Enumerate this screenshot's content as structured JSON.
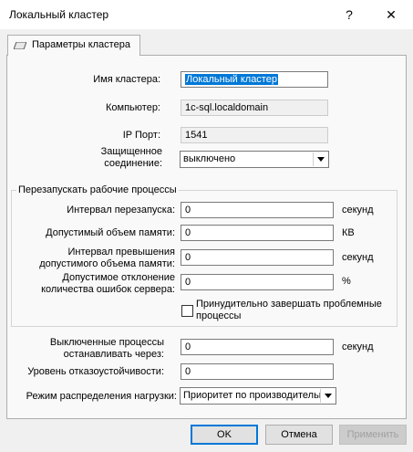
{
  "window": {
    "title": "Локальный кластер",
    "help": "?",
    "close": "✕"
  },
  "tab": {
    "label": "Параметры кластера",
    "icon": "cluster-icon"
  },
  "fields": {
    "cluster_name": {
      "label": "Имя кластера:",
      "value": "Локальный кластер"
    },
    "computer": {
      "label": "Компьютер:",
      "value": "1c-sql.localdomain"
    },
    "ip_port": {
      "label": "IP Порт:",
      "value": "1541"
    },
    "secure_connection": {
      "label_line1": "Защищенное",
      "label_line2": "соединение:",
      "value": "выключено"
    }
  },
  "restart_group": {
    "title": "Перезапускать рабочие процессы",
    "restart_interval": {
      "label": "Интервал перезапуска:",
      "value": "0",
      "unit": "секунд"
    },
    "memory_allowed": {
      "label": "Допустимый объем памяти:",
      "value": "0",
      "unit": "КВ"
    },
    "memory_exceed_interval": {
      "label_line1": "Интервал превышения",
      "label_line2": "допустимого объема памяти:",
      "value": "0",
      "unit": "секунд"
    },
    "error_deviation": {
      "label_line1": "Допустимое отклонение",
      "label_line2": "количества ошибок сервера:",
      "value": "0",
      "unit": "%"
    },
    "force_terminate": {
      "label_line1": "Принудительно завершать проблемные",
      "label_line2": "процессы",
      "checked": false
    }
  },
  "disabled_stop": {
    "label_line1": "Выключенные процессы",
    "label_line2": "останавливать через:",
    "value": "0",
    "unit": "секунд"
  },
  "fault_tolerance": {
    "label": "Уровень отказоустойчивости:",
    "value": "0"
  },
  "load_balancing": {
    "label": "Режим распределения нагрузки:",
    "value": "Приоритет по производительности"
  },
  "buttons": {
    "ok": "OK",
    "cancel": "Отмена",
    "apply": "Применить"
  },
  "colors": {
    "accent": "#0078d7",
    "client_bg": "#f0f0f0",
    "panel_bg": "#f9f9f9"
  }
}
